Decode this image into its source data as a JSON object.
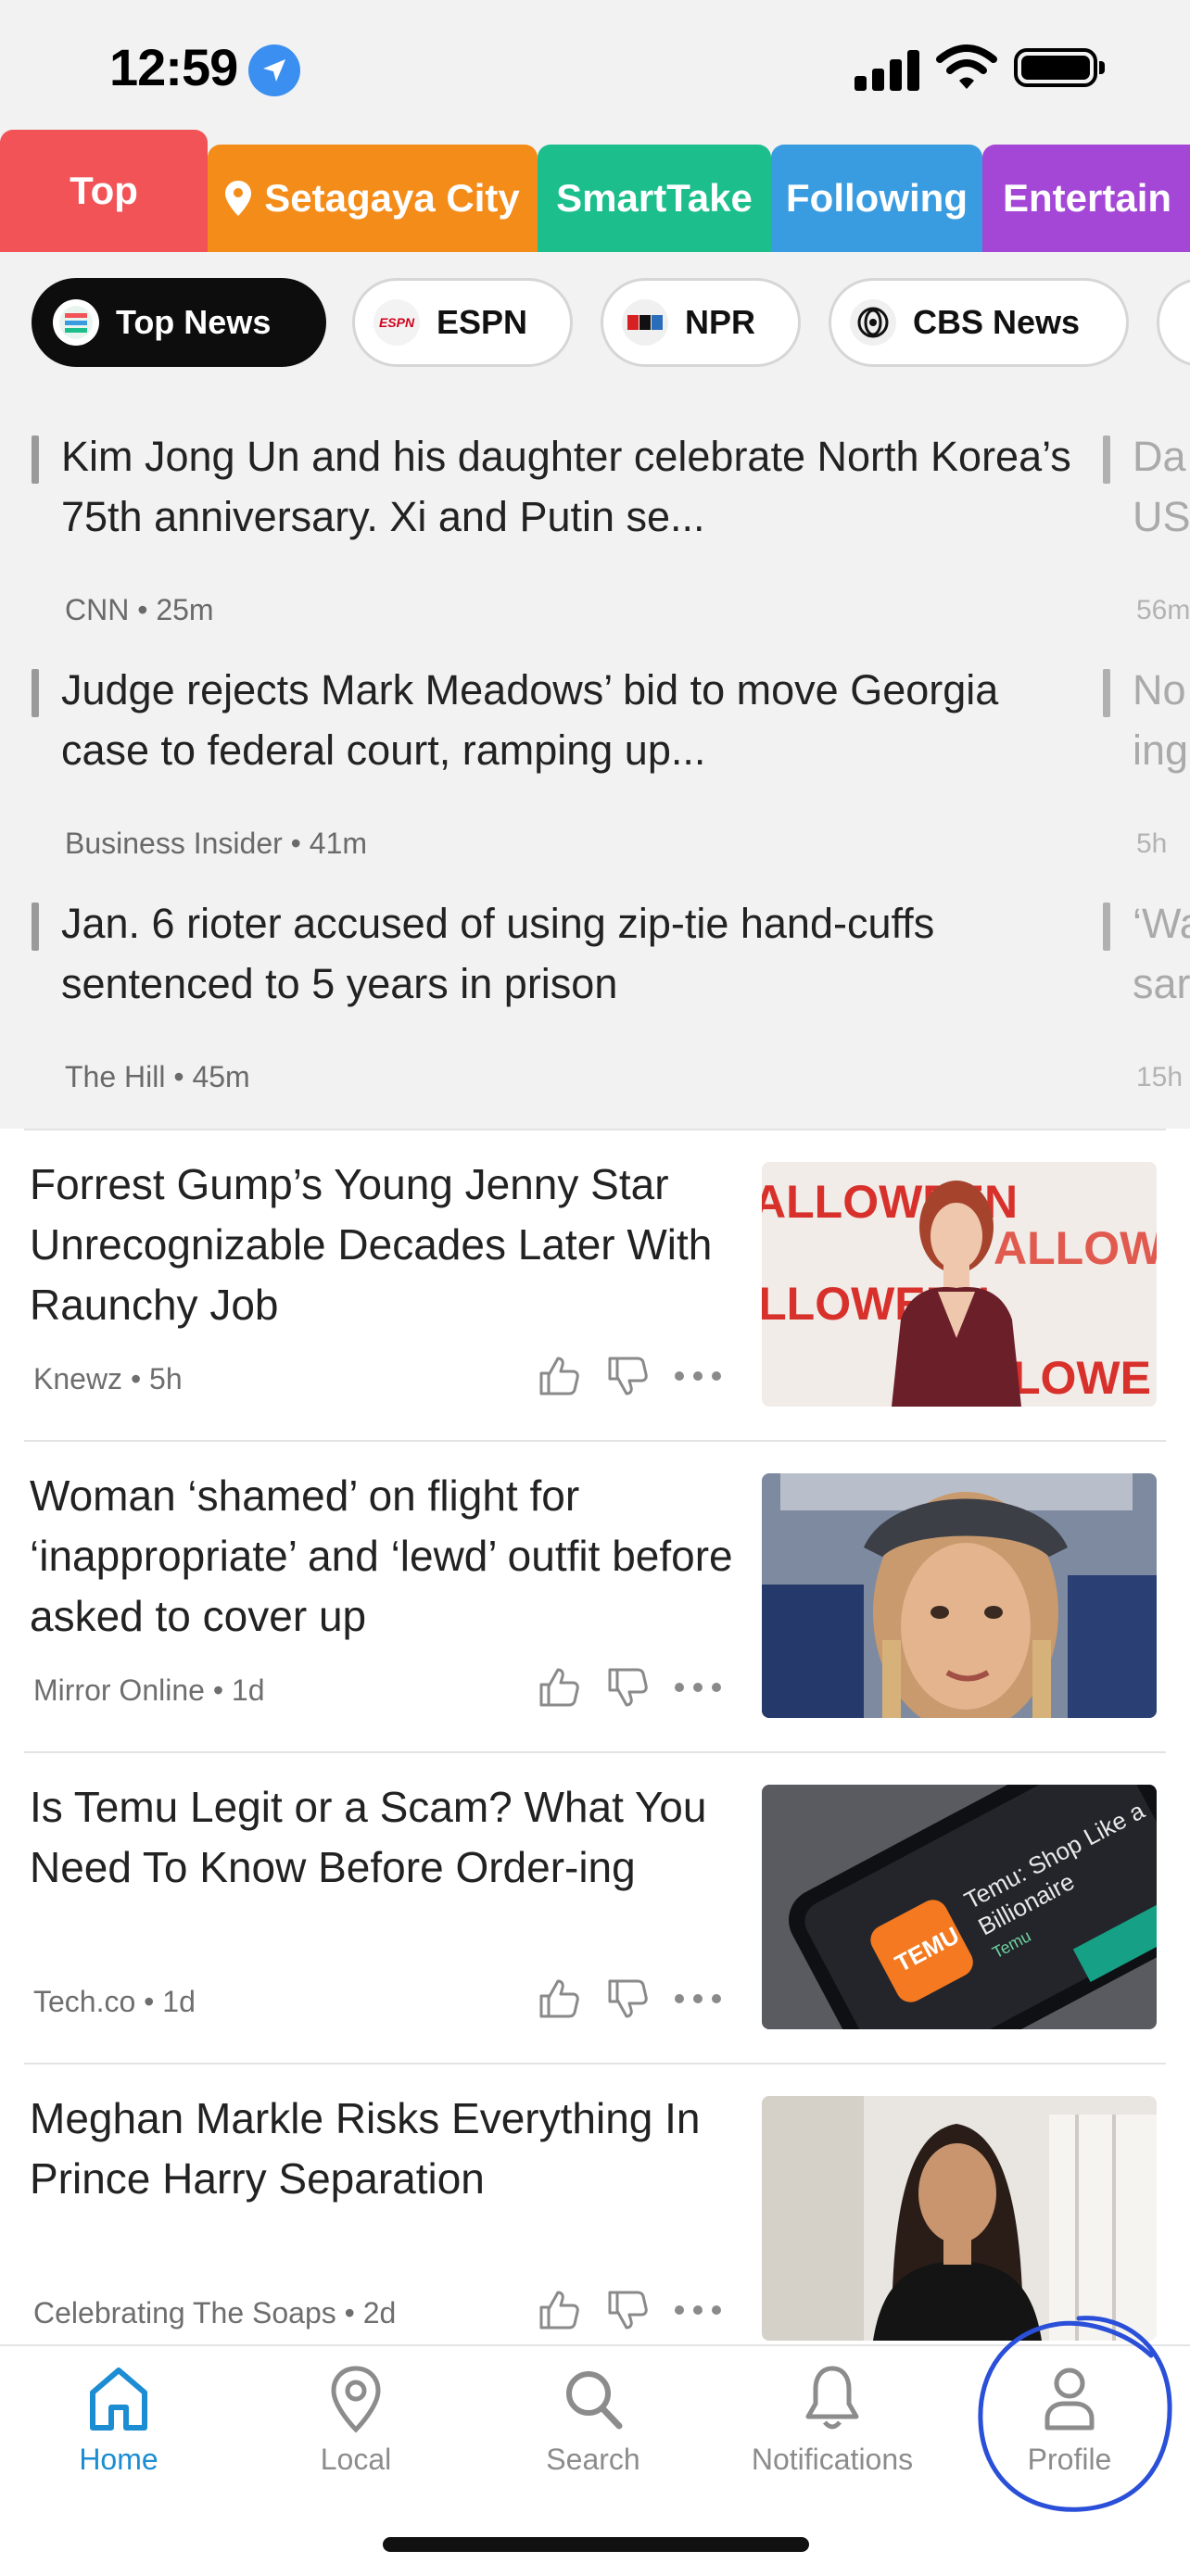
{
  "status_bar": {
    "time": "12:59"
  },
  "category_tabs": [
    {
      "label": "Top",
      "color": "#f15357",
      "active": true
    },
    {
      "label": "Setagaya City",
      "color": "#f48c1a",
      "active": false
    },
    {
      "label": "SmartTake",
      "color": "#1cbf8c",
      "active": false
    },
    {
      "label": "Following",
      "color": "#3a9ce0",
      "active": false
    },
    {
      "label": "Entertain",
      "color": "#a447d6",
      "active": false
    }
  ],
  "source_chips": [
    {
      "label": "Top News",
      "active": true
    },
    {
      "label": "ESPN",
      "logo": "espn-logo"
    },
    {
      "label": "NPR",
      "logo": "npr-logo"
    },
    {
      "label": "CBS News",
      "logo": "cbs-logo"
    }
  ],
  "top_stories": [
    {
      "title": "Kim Jong Un and his daughter celebrate North Korea’s 75th anniversary. Xi and Putin se...",
      "source": "CNN",
      "time": "25m"
    },
    {
      "title": "Judge rejects Mark Meadows’ bid to move Georgia case to federal court, ramping up...",
      "source": "Business Insider",
      "time": "41m"
    },
    {
      "title": "Jan. 6 rioter accused of using zip-tie hand-cuffs sentenced to 5 years in prison",
      "source": "The Hill",
      "time": "45m"
    }
  ],
  "peek_stories": [
    {
      "title": "Da\nUS",
      "time": "56m"
    },
    {
      "title": "No\ning",
      "time": "5h"
    },
    {
      "title": "‘Wa\nsar",
      "time": "15h"
    }
  ],
  "feed": [
    {
      "title": "Forrest Gump’s Young Jenny Star Unrecognizable Decades Later With Raunchy Job",
      "source": "Knewz",
      "time": "5h",
      "thumb": "red-carpet-photo"
    },
    {
      "title": "Woman ‘shamed’ on flight for ‘inappropriate’ and ‘lewd’ outfit before asked to cover up",
      "source": "Mirror Online",
      "time": "1d",
      "thumb": "airplane-selfie-photo"
    },
    {
      "title": "Is Temu Legit or a Scam? What You Need To Know Before Order-ing",
      "source": "Tech.co",
      "time": "1d",
      "thumb": "temu-phone-photo"
    },
    {
      "title": "Meghan Markle Risks Everything In Prince Harry Separation",
      "source": "Celebrating The Soaps",
      "time": "2d",
      "thumb": "portrait-photo"
    }
  ],
  "bottom_nav": [
    {
      "label": "Home",
      "icon": "home-icon",
      "active": true
    },
    {
      "label": "Local",
      "icon": "location-pin-icon"
    },
    {
      "label": "Search",
      "icon": "search-icon"
    },
    {
      "label": "Notifications",
      "icon": "bell-icon"
    },
    {
      "label": "Profile",
      "icon": "person-icon"
    }
  ],
  "colors": {
    "accent": "#1c8dd2",
    "annotation": "#2a4fd8"
  }
}
